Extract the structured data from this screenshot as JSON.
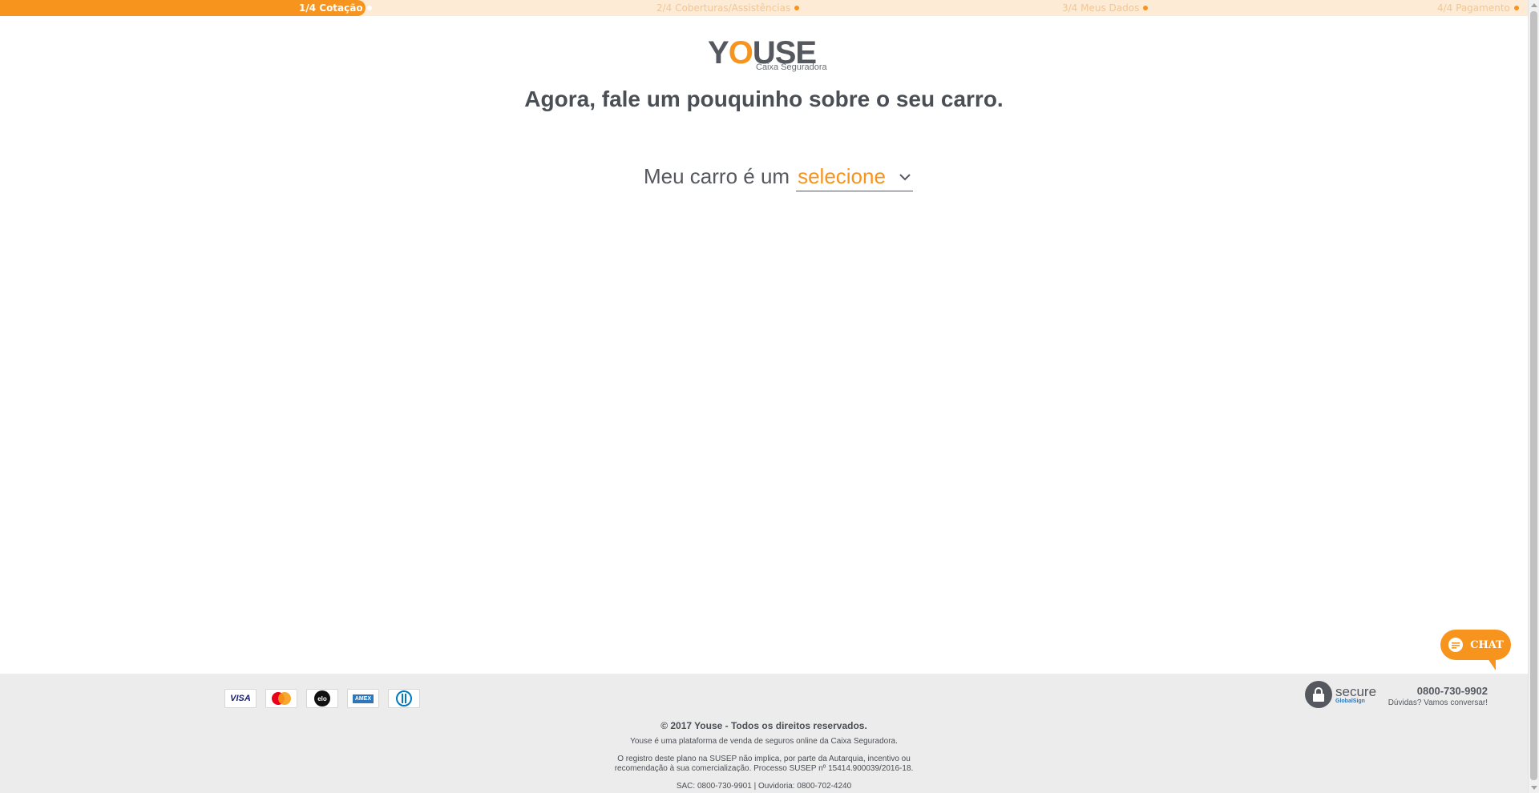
{
  "progress": {
    "fraction": 0.25,
    "steps": [
      {
        "label": "1/4 Cotação",
        "state": "active"
      },
      {
        "label": "2/4 Coberturas/Assistências",
        "state": "pending"
      },
      {
        "label": "3/4 Meus Dados",
        "state": "pending"
      },
      {
        "label": "4/4 Pagamento",
        "state": "pending"
      }
    ]
  },
  "logo": {
    "word_prefix": "Y",
    "word_o": "O",
    "word_suffix": "USE",
    "subtitle": "Caixa Seguradora"
  },
  "main": {
    "headline": "Agora, fale um pouquinho sobre o seu carro.",
    "question_prefix": "Meu carro é um",
    "select_value": "selecione",
    "select_icon": "chevron-down-icon"
  },
  "chat": {
    "label": "CHAT",
    "icon": "chat-bubble-icon"
  },
  "footer": {
    "cards": [
      {
        "name": "visa",
        "label": "VISA"
      },
      {
        "name": "mastercard",
        "label": ""
      },
      {
        "name": "elo",
        "label": "elo"
      },
      {
        "name": "amex",
        "label": "AMEX"
      },
      {
        "name": "diners",
        "label": ""
      }
    ],
    "secure": {
      "big": "secure",
      "small": "GlobalSign"
    },
    "phone": "0800-730-9902",
    "phone_sub": "Dúvidas? Vamos conversar!",
    "copyright": "© 2017 Youse - Todos os direitos reservados.",
    "platform_note": "Youse é uma plataforma de venda de seguros online da Caixa Seguradora.",
    "susep_line1": "O registro deste plano na SUSEP não implica, por parte da Autarquia, incentivo ou",
    "susep_line2": "recomendação à sua comercialização. Processo SUSEP nº 15414.900039/2016-18.",
    "sac": "SAC: 0800-730-9901 | Ouvidoria: 0800-702-4240"
  },
  "colors": {
    "accent": "#f7941d",
    "accent_light": "#fdebd6",
    "text": "#4a4f55",
    "footer_bg": "#ececec"
  }
}
